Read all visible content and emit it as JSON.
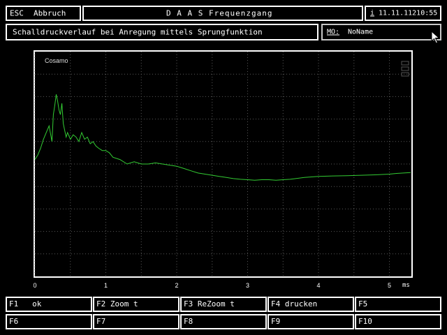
{
  "header": {
    "esc_label": "ESC",
    "abbruch_label": "Abbruch",
    "title": "D A A S  Frequenzgang",
    "info_icon_glyph": "i",
    "datetime": "11.11.11210:55"
  },
  "subheader": {
    "description": "Schalldruckverlauf bei Anregung mittels Sprungfunktion",
    "mo_label": "MO:",
    "mo_value": "NoName"
  },
  "colors": {
    "curve": "#33cc33",
    "grid": "#5a5a5a",
    "frame": "#ffffff",
    "bg": "#000000"
  },
  "icons": {
    "cursor": "mouse-pointer-icon"
  },
  "chart_data": {
    "type": "line",
    "legend_entry": "Cosamo",
    "xunit": "ms",
    "xlim": [
      0,
      5.3
    ],
    "ylim": [
      0,
      1
    ],
    "xticks": [
      0,
      1,
      2,
      3,
      4,
      5
    ],
    "xtick_labels": [
      "0",
      "1",
      "2",
      "3",
      "4",
      "5"
    ],
    "grid": true,
    "series": [
      {
        "x": [
          0,
          0.04,
          0.08,
          0.12,
          0.16,
          0.2,
          0.24,
          0.26,
          0.28,
          0.3,
          0.32,
          0.34,
          0.36,
          0.38,
          0.4,
          0.42,
          0.44,
          0.46,
          0.5,
          0.54,
          0.58,
          0.62,
          0.66,
          0.7,
          0.74,
          0.78,
          0.82,
          0.86,
          0.9,
          0.95,
          1.0,
          1.05,
          1.1,
          1.2,
          1.3,
          1.4,
          1.5,
          1.6,
          1.7,
          1.8,
          1.9,
          2.0,
          2.1,
          2.2,
          2.3,
          2.4,
          2.5,
          2.6,
          2.7,
          2.8,
          2.9,
          3.0,
          3.1,
          3.2,
          3.3,
          3.4,
          3.5,
          3.6,
          3.8,
          4.0,
          4.2,
          4.4,
          4.6,
          4.8,
          5.0,
          5.1,
          5.2,
          5.3
        ],
        "y": [
          0.52,
          0.54,
          0.57,
          0.61,
          0.64,
          0.67,
          0.6,
          0.72,
          0.76,
          0.81,
          0.78,
          0.74,
          0.72,
          0.77,
          0.68,
          0.65,
          0.62,
          0.64,
          0.61,
          0.63,
          0.62,
          0.6,
          0.64,
          0.61,
          0.62,
          0.59,
          0.6,
          0.58,
          0.57,
          0.56,
          0.56,
          0.55,
          0.53,
          0.52,
          0.5,
          0.51,
          0.5,
          0.5,
          0.505,
          0.5,
          0.495,
          0.49,
          0.48,
          0.47,
          0.46,
          0.455,
          0.45,
          0.445,
          0.44,
          0.435,
          0.432,
          0.43,
          0.428,
          0.43,
          0.43,
          0.428,
          0.43,
          0.432,
          0.44,
          0.445,
          0.447,
          0.448,
          0.45,
          0.452,
          0.455,
          0.458,
          0.46,
          0.462
        ]
      }
    ]
  },
  "fkeys": [
    [
      "F1   ok",
      "F2 Zoom t",
      "F3 ReZoom t",
      "F4 drucken",
      "F5"
    ],
    [
      "F6",
      "F7",
      "F8",
      "F9",
      "F10"
    ]
  ]
}
